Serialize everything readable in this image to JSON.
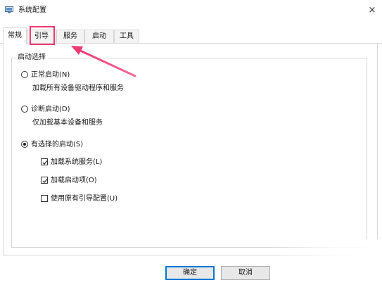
{
  "window": {
    "title": "系统配置",
    "icon": "msconfig-icon",
    "close_glyph": "×"
  },
  "tabs": [
    {
      "label": "常规",
      "active": true
    },
    {
      "label": "引导",
      "active": false,
      "highlighted": true
    },
    {
      "label": "服务",
      "active": false
    },
    {
      "label": "启动",
      "active": false
    },
    {
      "label": "工具",
      "active": false
    }
  ],
  "startup_group": {
    "legend": "启动选择",
    "options": [
      {
        "label": "正常启动(N)",
        "description": "加载所有设备驱动程序和服务",
        "selected": false
      },
      {
        "label": "诊断启动(D)",
        "description": "仅加载基本设备和服务",
        "selected": false
      },
      {
        "label": "有选择的启动(S)",
        "selected": true
      }
    ],
    "selective_items": [
      {
        "label": "加载系统服务(L)",
        "checked": true
      },
      {
        "label": "加载启动项(O)",
        "checked": true
      },
      {
        "label": "使用原有引导配置(U)",
        "checked": false
      }
    ]
  },
  "buttons": {
    "ok": "确定",
    "cancel": "取消"
  },
  "colors": {
    "annotation": "#ee3a72",
    "default_button_border": "#0078d7"
  }
}
